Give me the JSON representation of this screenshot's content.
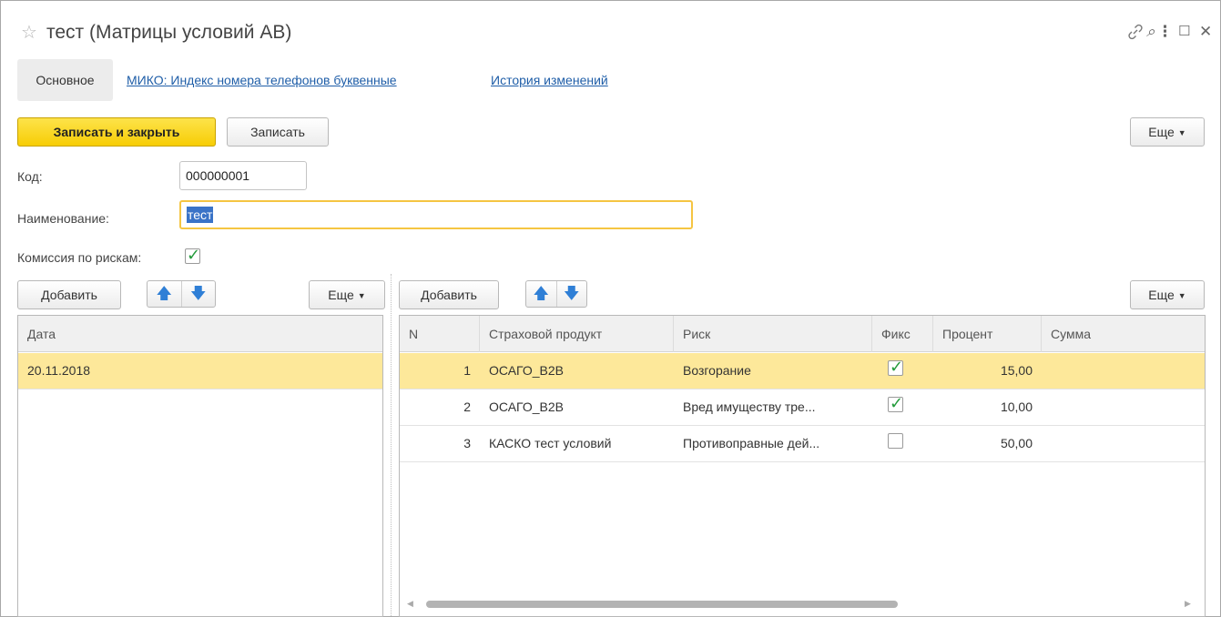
{
  "window": {
    "title": "тест (Матрицы условий АВ)",
    "icons": [
      "star-icon",
      "link-icon",
      "more-vertical-icon",
      "maximize-icon",
      "close-icon"
    ]
  },
  "nav": {
    "main": "Основное",
    "link1": "МИКО: Индекс номера телефонов буквенные",
    "link2": "История изменений"
  },
  "toolbar": {
    "save_close": "Записать и закрыть",
    "save": "Записать",
    "more": "Еще"
  },
  "form": {
    "code_label": "Код:",
    "code_value": "000000001",
    "name_label": "Наименование:",
    "name_value": "тест",
    "commission_label": "Комиссия по рискам:",
    "commission_checked": true
  },
  "left_panel": {
    "add": "Добавить",
    "more": "Еще",
    "columns": [
      "Дата"
    ],
    "rows": [
      {
        "date": "20.11.2018",
        "selected": true
      }
    ]
  },
  "right_panel": {
    "add": "Добавить",
    "more": "Еще",
    "columns": [
      "N",
      "Страховой продукт",
      "Риск",
      "Фикс",
      "Процент",
      "Сумма"
    ],
    "rows": [
      {
        "n": "1",
        "product": "ОСАГО_B2B",
        "risk": "Возгорание",
        "fix": true,
        "percent": "15,00",
        "sum": "",
        "selected": true
      },
      {
        "n": "2",
        "product": "ОСАГО_B2B",
        "risk": "Вред имуществу тре...",
        "fix": true,
        "percent": "10,00",
        "sum": "",
        "selected": false
      },
      {
        "n": "3",
        "product": "КАСКО тест условий",
        "risk": "Противоправные дей...",
        "fix": false,
        "percent": "50,00",
        "sum": "",
        "selected": false
      }
    ]
  },
  "colors": {
    "primary_button": "#f7cd05",
    "selected_row": "#fde89a",
    "link": "#1f5ea8",
    "check": "#239b3b",
    "arrow": "#2f7fd6"
  }
}
